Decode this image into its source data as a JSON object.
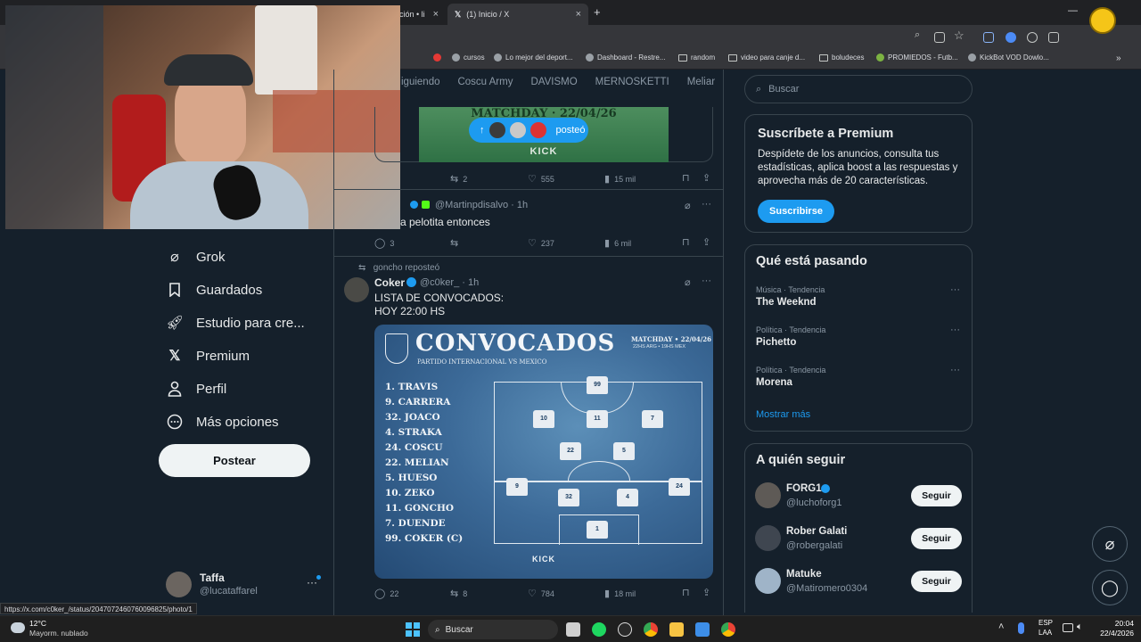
{
  "browser": {
    "tabs": [
      {
        "label": "ción • li",
        "active": false
      },
      {
        "label": "(1) Inicio / X",
        "active": true
      }
    ],
    "new_tab": "+",
    "bookmarks": [
      "cursos",
      "Lo mejor del deport...",
      "Dashboard - Restre...",
      "random",
      "video para canje d...",
      "boludeces",
      "PROMIEDOS - Futb...",
      "KickBot VOD Dowlo..."
    ],
    "bookmarks_more": "»",
    "status_url": "https://x.com/c0ker_/status/2047072460760096825/photo/1"
  },
  "sidebar": {
    "items": [
      {
        "label": "Grok",
        "icon": "grok-icon"
      },
      {
        "label": "Guardados",
        "icon": "bookmark-icon"
      },
      {
        "label": "Estudio para cre...",
        "icon": "rocket-icon"
      },
      {
        "label": "Premium",
        "icon": "x-logo-icon"
      },
      {
        "label": "Perfil",
        "icon": "person-icon"
      },
      {
        "label": "Más opciones",
        "icon": "more-circle-icon"
      }
    ],
    "post_button": "Postear",
    "account": {
      "name": "Taffa",
      "handle": "@lucataffarel"
    }
  },
  "timeline": {
    "tabs": [
      "iguiendo",
      "Coscu Army",
      "DAVISMO",
      "MERNOSKETTI",
      "Meliar"
    ],
    "new_posts_pill": "posteó",
    "tweet1": {
      "image_text": "MATCHDAY · 22/04/26",
      "image_brand": "KICK",
      "replies": "",
      "retweets": "2",
      "likes": "555",
      "views": "15 mil"
    },
    "tweet2": {
      "handle": "@Martinpdisalvo",
      "time": "· 1h",
      "text": "a pelotita entonces",
      "replies": "3",
      "likes": "237",
      "views": "6 mil"
    },
    "tweet3": {
      "repost_note": "goncho reposteó",
      "name": "Coker",
      "handle": "@c0ker_",
      "time": "· 1h",
      "text_line1": "LISTA DE CONVOCADOS:",
      "text_line2": "HOY 22:00 HS",
      "replies": "22",
      "retweets": "8",
      "likes": "784",
      "views": "18 mil",
      "image": {
        "title": "CONVOCADOS",
        "subtitle": "PARTIDO INTERNACIONAL VS MEXICO",
        "matchday": "MATCHDAY • 22/04/26",
        "times": "22HS ARG • 19HS MEX",
        "players": [
          "1. TRAVIS",
          "9. CARRERA",
          "32. JOACO",
          "4. STRAKA",
          "24. COSCU",
          "22. MELIAN",
          "5. HUESO",
          "10. ZEKO",
          "11. GONCHO",
          "7. DUENDE",
          "99. COKER (C)"
        ],
        "brand": "KICK"
      }
    }
  },
  "right": {
    "search_placeholder": "Buscar",
    "premium": {
      "title": "Suscríbete a Premium",
      "body": "Despídete de los anuncios, consulta tus estadísticas, aplica boost a las respuestas y aprovecha más de 20 características.",
      "button": "Suscribirse"
    },
    "trends": {
      "title": "Qué está pasando",
      "items": [
        {
          "category": "Música · Tendencia",
          "name": "The Weeknd"
        },
        {
          "category": "Política · Tendencia",
          "name": "Pichetto"
        },
        {
          "category": "Política · Tendencia",
          "name": "Morena"
        }
      ],
      "show_more": "Mostrar más"
    },
    "follow": {
      "title": "A quién seguir",
      "items": [
        {
          "name": "FORG1",
          "handle": "@luchoforg1",
          "button": "Seguir"
        },
        {
          "name": "Rober Galati",
          "handle": "@robergalati",
          "button": "Seguir"
        },
        {
          "name": "Matuke",
          "handle": "@Matiromero0304",
          "button": "Seguir"
        }
      ]
    }
  },
  "taskbar": {
    "weather_temp": "12°C",
    "weather_desc": "Mayorm. nublado",
    "search": "Buscar",
    "lang_top": "ESP",
    "lang_bottom": "LAA",
    "time": "20:04",
    "date": "22/4/2026"
  }
}
